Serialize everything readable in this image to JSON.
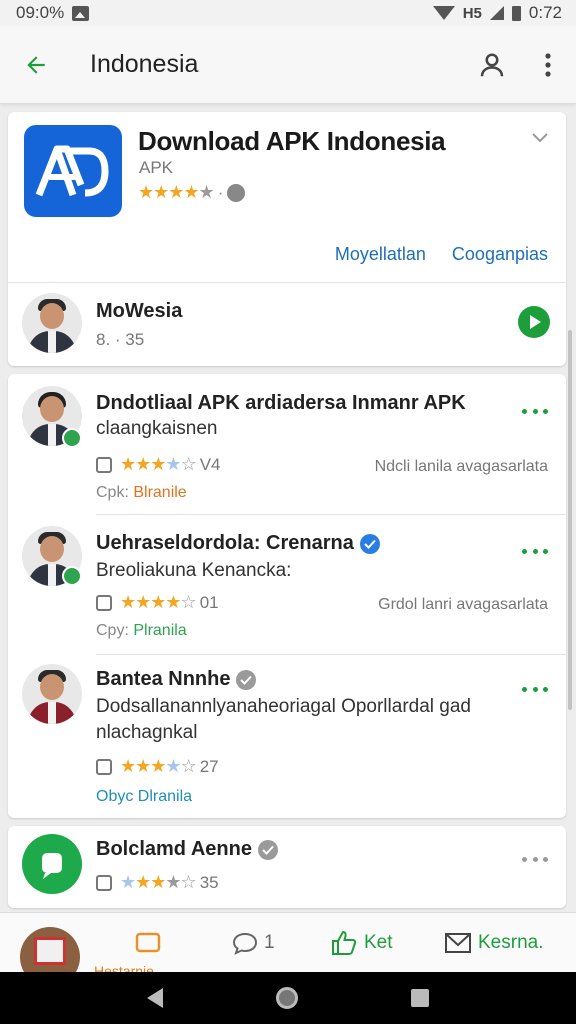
{
  "status_bar": {
    "time_left": "09:0%",
    "time_right": "0:72",
    "indicator": "H5"
  },
  "app_bar": {
    "title": "Indonesia"
  },
  "app_card": {
    "name": "Download APK Indonesia",
    "subtitle": "APK",
    "rating_stars": 4,
    "links": [
      "Moyellatlan",
      "Cooganpias"
    ]
  },
  "author": {
    "name": "MoWesia",
    "meta": "8. · 35"
  },
  "reviews": [
    {
      "title": "Dndotliaal APK ardiadersa Inmanr APK",
      "text": "claangkaisnen",
      "rating_count": "V4",
      "date": "Ndcli lanila avagasarlata",
      "meta_prefix": "Cpk: ",
      "meta_tag": "Blranile"
    },
    {
      "title": "Uehraseldordola: Crenarna",
      "text": "Breoliakuna Kenancka:",
      "rating_count": "01",
      "date": "Grdol lanri avagasarlata",
      "meta_prefix": "Cpy: ",
      "meta_tag": "Plranila"
    },
    {
      "title": "Bantea Nnnhe",
      "text": "Dodsallanannlyanaheoriagal Oporllardal gad nlachagnkal",
      "rating_count": "27",
      "meta_prefix": "Obyc ",
      "meta_tag": "Dlranila"
    }
  ],
  "last_item": {
    "title": "Bolclamd Aenne",
    "rating_count": "35"
  },
  "bottom_nav": {
    "thumb_label": "Hestarnie",
    "comment_count": "1",
    "like_label": "Ket",
    "mail_label": "Kesrna."
  },
  "colors": {
    "accent_green": "#1e9e3b",
    "link_blue": "#1f6fb5",
    "app_icon_blue": "#1565d8",
    "star_gold": "#f4a623"
  }
}
